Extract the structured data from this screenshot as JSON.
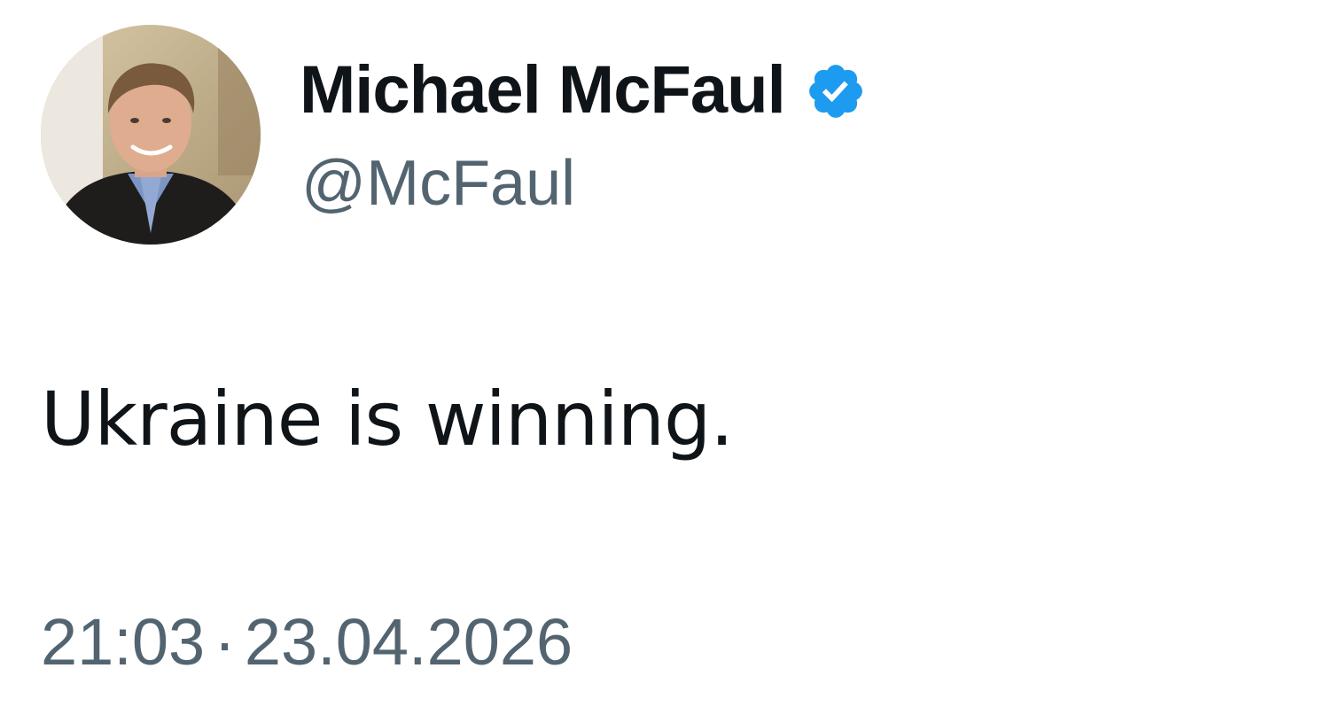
{
  "tweet": {
    "author": {
      "display_name": "Michael McFaul",
      "handle": "@McFaul",
      "verified": true,
      "verified_icon": "verified-badge-icon",
      "verified_color": "#1d9bf0"
    },
    "text": "Ukraine is winning.",
    "time": "21:03",
    "separator": "·",
    "date": "23.04.2026"
  },
  "colors": {
    "name": "#0f1419",
    "secondary": "#536471",
    "background": "#ffffff"
  }
}
